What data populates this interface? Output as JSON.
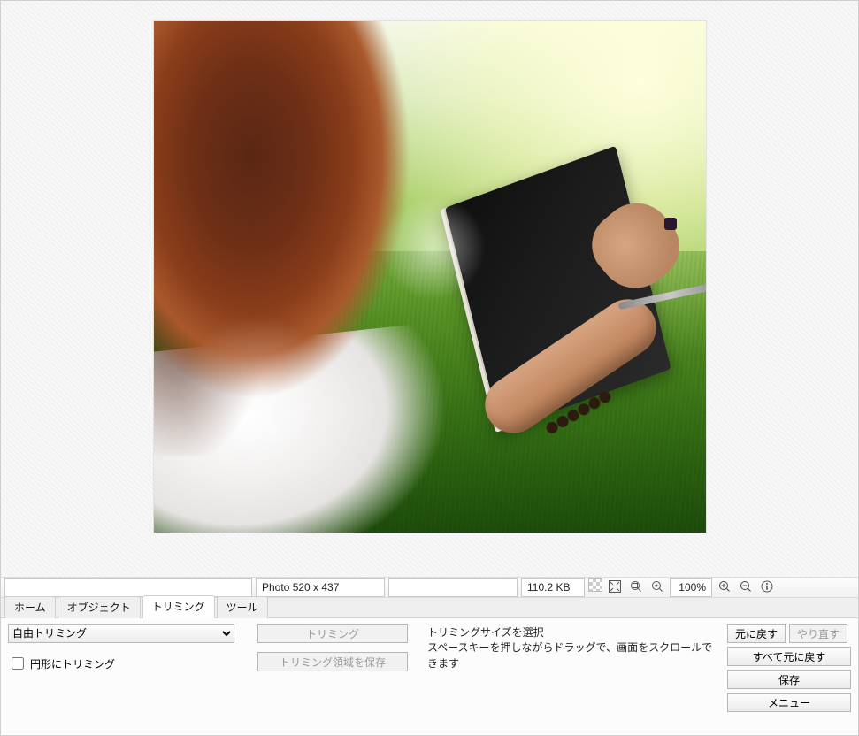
{
  "status": {
    "dimensions_label": "Photo 520 x 437",
    "filesize": "110.2 KB",
    "zoom": "100%"
  },
  "tabs": {
    "home": "ホーム",
    "object": "オブジェクト",
    "trimming": "トリミング",
    "tool": "ツール"
  },
  "panel": {
    "mode_selected": "自由トリミング",
    "circle_trim_label": "円形にトリミング",
    "btn_trim": "トリミング",
    "btn_save_area": "トリミング領域を保存",
    "hint_line1": "トリミングサイズを選択",
    "hint_line2": "スペースキーを押しながらドラッグで、画面をスクロールできます"
  },
  "right": {
    "undo": "元に戻す",
    "redo": "やり直す",
    "undo_all": "すべて元に戻す",
    "save": "保存",
    "menu": "メニュー"
  },
  "icon_titles": {
    "transparency": "transparency-icon",
    "fit": "fit-window-icon",
    "actual": "actual-size-icon",
    "zoom_reset": "zoom-reset-icon",
    "zoom_in": "zoom-in-icon",
    "zoom_out": "zoom-out-icon",
    "info": "info-icon"
  }
}
